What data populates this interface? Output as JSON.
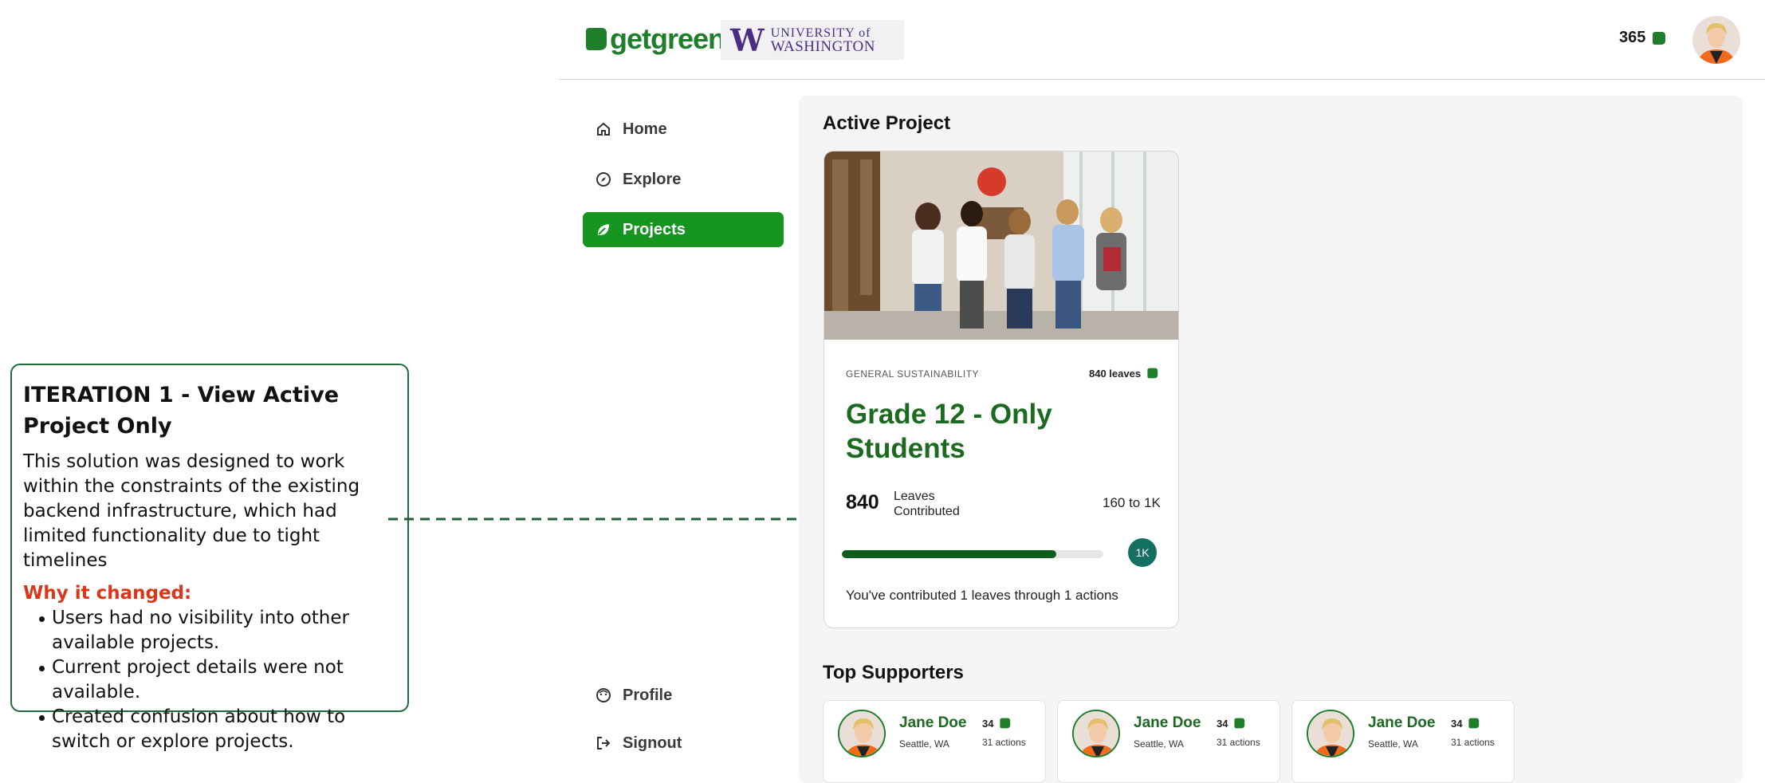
{
  "annotation": {
    "title": "ITERATION 1 - View Active Project Only",
    "description": "This solution was designed to work within the constraints of the existing backend infrastructure, which had limited functionality due to tight timelines",
    "why_label": "Why it changed:",
    "reasons": [
      "Users had no visibility into other available projects.",
      "Current project details were not available.",
      "Created confusion about how to switch or explore projects."
    ]
  },
  "header": {
    "logo_text": "getgreen",
    "uw_line1": "UNIVERSITY of",
    "uw_line2": "WASHINGTON",
    "points": "365"
  },
  "sidebar": {
    "items": [
      {
        "label": "Home",
        "icon": "home-icon"
      },
      {
        "label": "Explore",
        "icon": "compass-icon"
      },
      {
        "label": "Projects",
        "icon": "leaf-icon"
      }
    ],
    "bottom": [
      {
        "label": "Profile",
        "icon": "face-icon"
      },
      {
        "label": "Signout",
        "icon": "signout-icon"
      }
    ]
  },
  "main": {
    "active_title": "Active Project",
    "card": {
      "category": "GENERAL SUSTAINABILITY",
      "leaves": "840 leaves",
      "title": "Grade 12 - Only Students",
      "contributed_num": "840",
      "contributed_label_1": "Leaves",
      "contributed_label_2": "Contributed",
      "range": "160 to 1K",
      "progress": 0.82,
      "goal": "1K",
      "summary": "You've contributed 1 leaves through 1 actions"
    },
    "supporters_title": "Top Supporters",
    "supporters": [
      {
        "name": "Jane Doe",
        "location": "Seattle, WA",
        "leaves": "34",
        "actions": "31 actions"
      },
      {
        "name": "Jane Doe",
        "location": "Seattle, WA",
        "leaves": "34",
        "actions": "31 actions"
      },
      {
        "name": "Jane Doe",
        "location": "Seattle, WA",
        "leaves": "34",
        "actions": "31 actions"
      }
    ]
  },
  "colors": {
    "brand_green": "#15951f",
    "dark_green": "#1b6a1f",
    "annotation_border": "#1f6b3a",
    "why_red": "#d9361a",
    "uw_purple": "#4b2e83"
  }
}
